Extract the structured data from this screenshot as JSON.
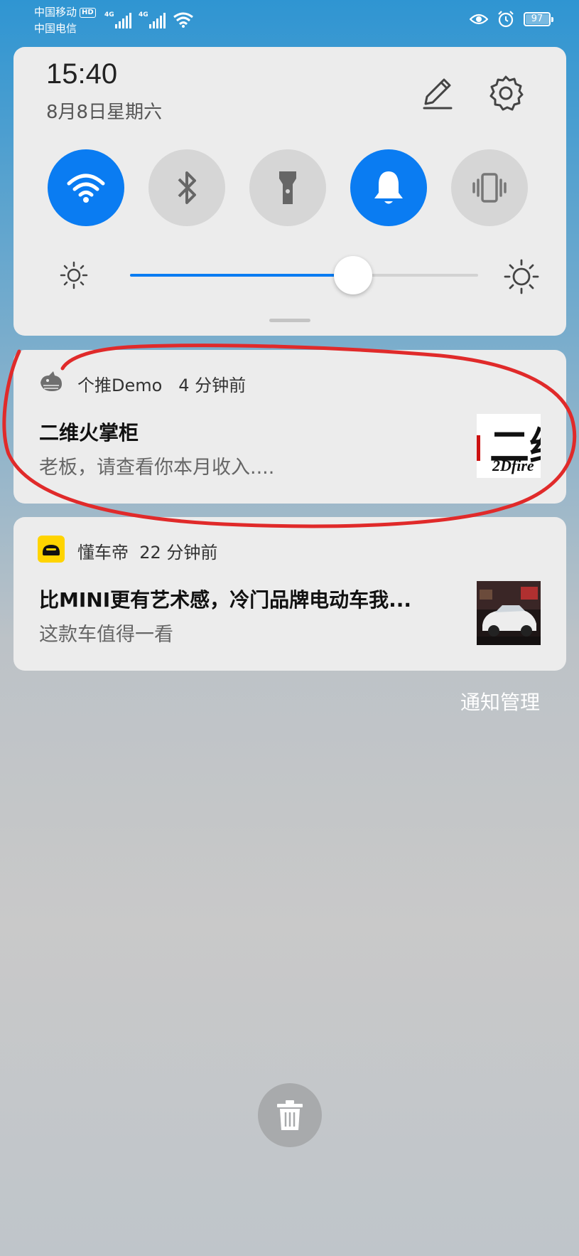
{
  "status_bar": {
    "carrier1": "中国移动",
    "hd": "HD",
    "carrier2": "中国电信",
    "net1": "4G",
    "net2": "4G",
    "battery": "97",
    "battery_level": 0.97
  },
  "panel": {
    "time": "15:40",
    "date": "8月8日星期六",
    "tiles": [
      {
        "name": "wifi-icon",
        "on": true
      },
      {
        "name": "bluetooth-icon",
        "on": false
      },
      {
        "name": "flashlight-icon",
        "on": false
      },
      {
        "name": "bell-icon",
        "on": true
      },
      {
        "name": "vibrate-icon",
        "on": false
      }
    ],
    "brightness_level": 0.64,
    "accent_color": "#0a7cf2"
  },
  "notifications": [
    {
      "app": "个推Demo",
      "time": "4 分钟前",
      "title": "二维火掌柜",
      "body": "老板，请查看你本月收入....",
      "thumb_big": "二维",
      "thumb_small": "2Dfire"
    },
    {
      "app": "懂车帝",
      "time": "22 分钟前",
      "title": "比MINI更有艺术感，冷门品牌电动车我...",
      "body": "这款车值得一看"
    }
  ],
  "manage_label": "通知管理",
  "annotation_color": "#e02a2a"
}
